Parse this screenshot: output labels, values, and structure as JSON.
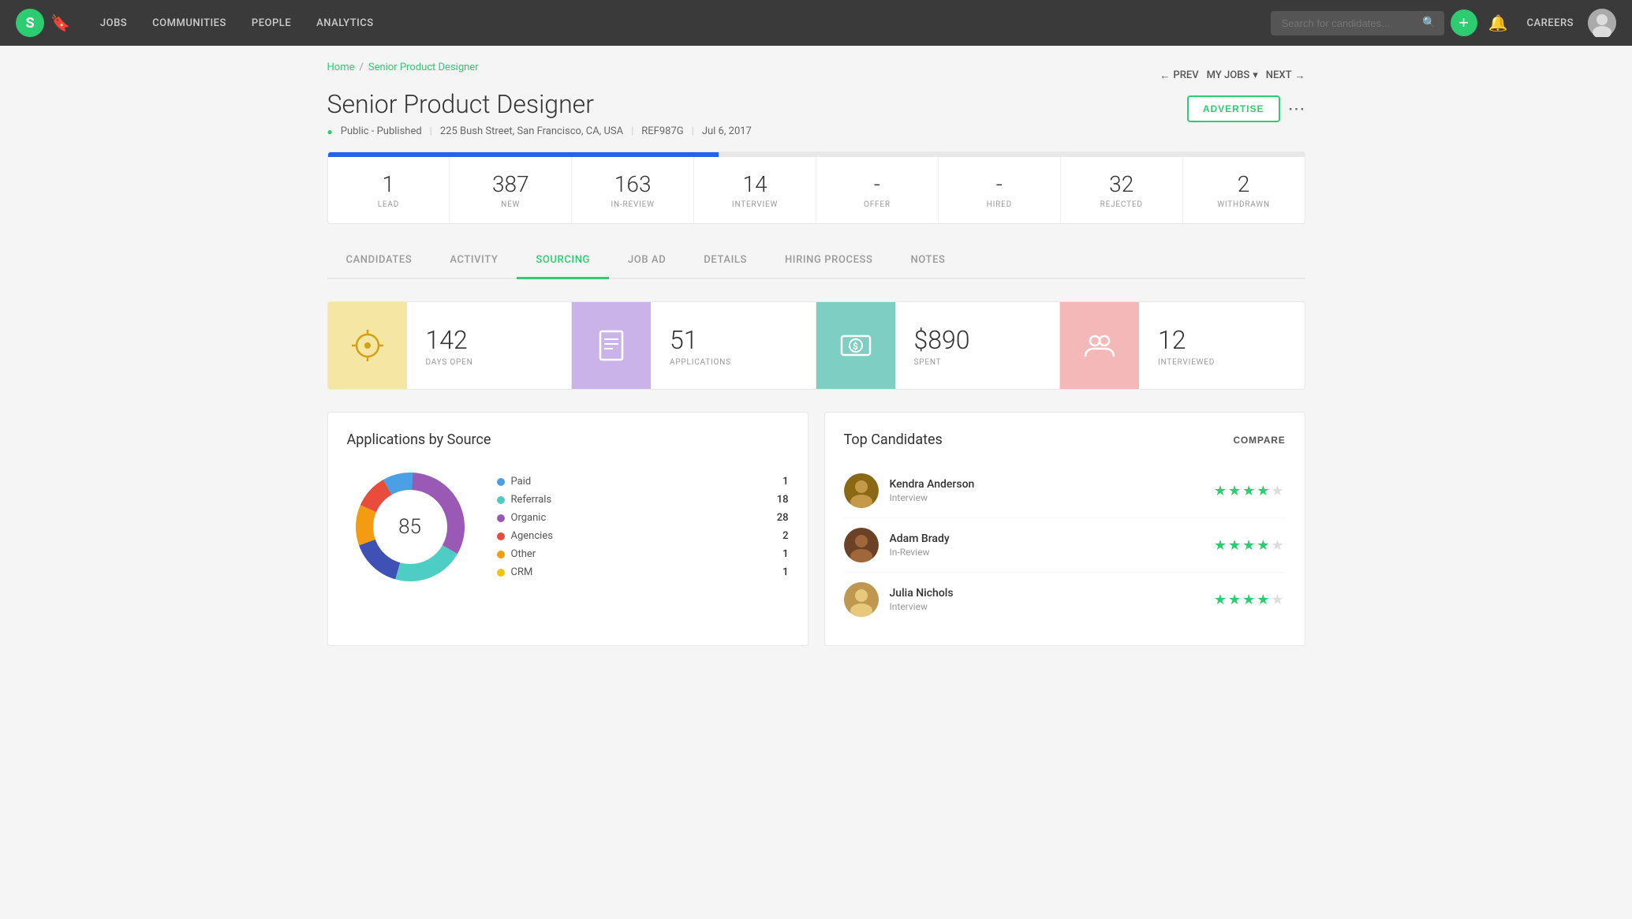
{
  "nav": {
    "logo": "S",
    "links": [
      "JOBS",
      "COMMUNITIES",
      "PEOPLE",
      "ANALYTICS"
    ],
    "search_placeholder": "Search for candidates...",
    "add_label": "+",
    "careers_label": "CAREERS"
  },
  "breadcrumb": {
    "home": "Home",
    "separator": "/",
    "current": "Senior Product Designer"
  },
  "header": {
    "title": "Senior Product Designer",
    "status": "Public - Published",
    "location": "225 Bush Street, San Francisco, CA, USA",
    "ref": "REF987G",
    "date": "Jul 6, 2017",
    "prev_label": "PREV",
    "my_jobs_label": "MY JOBS",
    "next_label": "NEXT",
    "advertise_label": "ADVERTISE"
  },
  "pipeline": {
    "stages": [
      {
        "num": "1",
        "label": "LEAD"
      },
      {
        "num": "387",
        "label": "NEW"
      },
      {
        "num": "163",
        "label": "IN-REVIEW"
      },
      {
        "num": "14",
        "label": "INTERVIEW"
      },
      {
        "num": "-",
        "label": "OFFER"
      },
      {
        "num": "-",
        "label": "HIRED"
      },
      {
        "num": "32",
        "label": "REJECTED"
      },
      {
        "num": "2",
        "label": "WITHDRAWN"
      }
    ]
  },
  "tabs": [
    {
      "id": "candidates",
      "label": "CANDIDATES"
    },
    {
      "id": "activity",
      "label": "ACTIVITY"
    },
    {
      "id": "sourcing",
      "label": "SOURCING",
      "active": true
    },
    {
      "id": "job-ad",
      "label": "JOB AD"
    },
    {
      "id": "details",
      "label": "DETAILS"
    },
    {
      "id": "hiring-process",
      "label": "HIRING PROCESS"
    },
    {
      "id": "notes",
      "label": "NOTES"
    }
  ],
  "sourcing": {
    "stats": [
      {
        "icon": "☀",
        "color": "yellow",
        "value": "142",
        "label": "DAYS OPEN"
      },
      {
        "icon": "📄",
        "color": "purple",
        "value": "51",
        "label": "APPLICATIONS"
      },
      {
        "icon": "💲",
        "color": "teal",
        "value": "$890",
        "label": "SPENT"
      },
      {
        "icon": "👥",
        "color": "salmon",
        "value": "12",
        "label": "INTERVIEWED"
      }
    ]
  },
  "applications_by_source": {
    "title": "Applications by Source",
    "total": "85",
    "legend": [
      {
        "label": "Paid",
        "count": "1",
        "color": "#4b9fe5"
      },
      {
        "label": "Referrals",
        "count": "18",
        "color": "#4ecdc4"
      },
      {
        "label": "Organic",
        "count": "28",
        "color": "#9b59b6"
      },
      {
        "label": "Agencies",
        "count": "2",
        "color": "#e74c3c"
      },
      {
        "label": "Other",
        "count": "1",
        "color": "#f39c12"
      },
      {
        "label": "CRM",
        "count": "1",
        "color": "#f1c40f"
      }
    ],
    "donut_segments": [
      {
        "label": "Organic",
        "pct": 33,
        "color": "#9b59b6"
      },
      {
        "label": "Referrals",
        "pct": 21,
        "color": "#4ecdc4"
      },
      {
        "label": "Blue-purple",
        "pct": 15,
        "color": "#3f51b5"
      },
      {
        "label": "Orange",
        "pct": 12,
        "color": "#f39c12"
      },
      {
        "label": "Red",
        "pct": 10,
        "color": "#e74c3c"
      },
      {
        "label": "Paid",
        "pct": 9,
        "color": "#4b9fe5"
      }
    ]
  },
  "top_candidates": {
    "title": "Top Candidates",
    "compare_label": "COMPARE",
    "candidates": [
      {
        "name": "Kendra Anderson",
        "stage": "Interview",
        "stars": 4,
        "half": false
      },
      {
        "name": "Adam Brady",
        "stage": "In-Review",
        "stars": 4,
        "half": false
      },
      {
        "name": "Julia Nichols",
        "stage": "Interview",
        "stars": 4,
        "half": false
      }
    ]
  }
}
